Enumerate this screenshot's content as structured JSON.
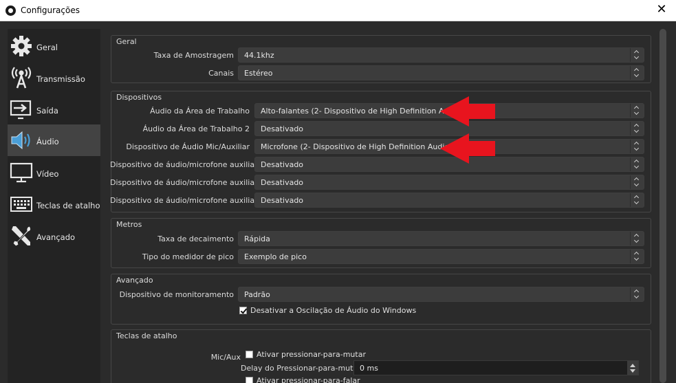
{
  "window": {
    "title": "Configurações",
    "close_glyph": "✕"
  },
  "sidebar": {
    "items": [
      {
        "label": "Geral",
        "icon": "gear-icon",
        "active": false
      },
      {
        "label": "Transmissão",
        "icon": "broadcast-icon",
        "active": false
      },
      {
        "label": "Saída",
        "icon": "output-icon",
        "active": false
      },
      {
        "label": "Áudio",
        "icon": "speaker-icon",
        "active": true
      },
      {
        "label": "Vídeo",
        "icon": "monitor-icon",
        "active": false
      },
      {
        "label": "Teclas de atalho",
        "icon": "keyboard-icon",
        "active": false
      },
      {
        "label": "Avançado",
        "icon": "tools-icon",
        "active": false
      }
    ]
  },
  "groups": {
    "geral": {
      "title": "Geral",
      "rows": [
        {
          "label": "Taxa de Amostragem",
          "value": "44.1khz"
        },
        {
          "label": "Canais",
          "value": "Estéreo"
        }
      ]
    },
    "dispositivos": {
      "title": "Dispositivos",
      "rows": [
        {
          "label": "Áudio da Área de Trabalho",
          "value": "Alto-falantes (2- Dispositivo de High Definition Audio)"
        },
        {
          "label": "Áudio da Área de Trabalho 2",
          "value": "Desativado"
        },
        {
          "label": "Dispositivo de Áudio Mic/Auxiliar",
          "value": "Microfone (2- Dispositivo de High Definition Audio)"
        },
        {
          "label": "Dispositivo de áudio/microfone auxiliar 2",
          "value": "Desativado"
        },
        {
          "label": "Dispositivo de áudio/microfone auxiliar 3",
          "value": "Desativado"
        },
        {
          "label": "Dispositivo de áudio/microfone auxiliar 4",
          "value": "Desativado"
        }
      ]
    },
    "metros": {
      "title": "Metros",
      "rows": [
        {
          "label": "Taxa de decaimento",
          "value": "Rápida"
        },
        {
          "label": "Tipo do medidor de pico",
          "value": "Exemplo de pico"
        }
      ]
    },
    "avancado": {
      "title": "Avançado",
      "rows": [
        {
          "label": "Dispositivo de monitoramento",
          "value": "Padrão"
        }
      ],
      "checkbox": {
        "label": "Desativar a Oscilação de Áudio do Windows",
        "checked": true
      }
    },
    "teclas": {
      "title": "Teclas de atalho",
      "source_label": "Mic/Aux",
      "push_to_mute": {
        "label": "Ativar pressionar-para-mutar",
        "checked": false
      },
      "delay": {
        "label": "Delay do Pressionar-para-mutar",
        "value": "0 ms"
      },
      "push_to_talk": {
        "label": "Ativar pressionar-para-falar",
        "checked": false
      }
    }
  },
  "annotations": {
    "arrow_color": "#e8141e"
  }
}
